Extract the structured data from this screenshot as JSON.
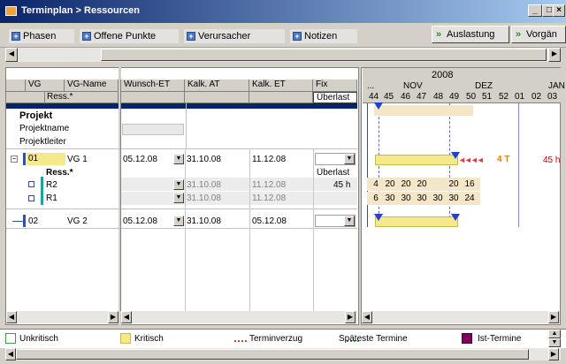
{
  "window": {
    "title": "Terminplan > Ressourcen"
  },
  "toolbar": {
    "phasen": "Phasen",
    "offene": "Offene Punkte",
    "verursacher": "Verursacher",
    "notizen": "Notizen",
    "auslastung": "Auslastung",
    "vorgaenge": "Vorgän"
  },
  "grid": {
    "col_vg": "VG",
    "col_vgname": "VG-Name",
    "col_ress": "Ress.*",
    "col_wunsch": "Wunsch-ET",
    "col_kalkat": "Kalk. AT",
    "col_kalket": "Kalk. ET",
    "col_fix": "Fix",
    "col_ueberlast": "Überlast"
  },
  "project": {
    "label": "Projekt",
    "name": "Projektname",
    "leiter": "Projektleiter"
  },
  "rows": {
    "vg1": {
      "nr": "01",
      "name": "VG 1",
      "wunsch": "05.12.08",
      "kalkat": "31.10.08",
      "kalket": "11.12.08"
    },
    "ress_header": {
      "label": "Ress.*",
      "ueberlast": "Überlast"
    },
    "r2": {
      "name": "R2",
      "kalkat": "31.10.08",
      "kalket": "11.12.08",
      "ueberlast": "45 h"
    },
    "r1": {
      "name": "R1",
      "kalkat": "31.10.08",
      "kalket": "11.12.08"
    },
    "vg2": {
      "nr": "02",
      "name": "VG 2",
      "wunsch": "05.12.08",
      "kalkat": "31.10.08",
      "kalket": "05.12.08"
    }
  },
  "timeline": {
    "year": "2008",
    "dots": "...",
    "months": [
      "NOV",
      "DEZ",
      "JAN"
    ],
    "weeks": [
      "44",
      "45",
      "46",
      "47",
      "48",
      "49",
      "50",
      "51",
      "52",
      "01",
      "02",
      "03"
    ]
  },
  "gantt": {
    "vg1_delay": "4 T",
    "vg1_overload": "45 h",
    "r2_values": [
      "4",
      "20",
      "20",
      "20",
      "",
      "20",
      "16"
    ],
    "r1_values": [
      "6",
      "30",
      "30",
      "30",
      "30",
      "30",
      "24"
    ]
  },
  "legend": {
    "unkritisch": "Unkritisch",
    "kritisch": "Kritisch",
    "terminverzug": "Terminverzug",
    "spaeteste": "Späteste Termine",
    "ist": "Ist-Termine"
  },
  "colors": {
    "critical": "#f5e98c",
    "delay": "#e04040",
    "late": "#40a040",
    "ist": "#800060",
    "delay_text": "#e08000",
    "overload_text": "#c00000"
  }
}
